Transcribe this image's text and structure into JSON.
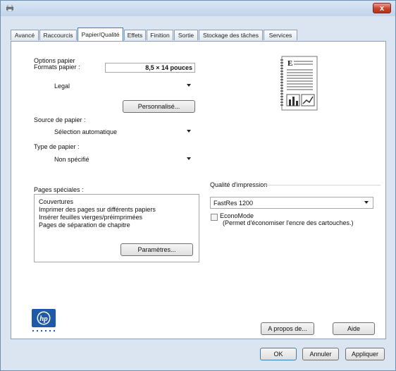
{
  "window": {
    "close_label": "x"
  },
  "tabs": [
    "Avancé",
    "Raccourcis",
    "Papier/Qualité",
    "Effets",
    "Finition",
    "Sortie",
    "Stockage des tâches",
    "Services"
  ],
  "active_tab": "Papier/Qualité",
  "paper_options": {
    "group_label": "Options papier",
    "formats_label": "Formats papier :",
    "format_size": "8,5 × 14 pouces",
    "format_selected": "Legal",
    "custom_button": "Personnalisé...",
    "source_label": "Source de papier :",
    "source_selected": "Sélection automatique",
    "type_label": "Type de papier :",
    "type_selected": "Non spécifié"
  },
  "special_pages": {
    "label": "Pages spéciales :",
    "items": [
      "Couvertures",
      "Imprimer des pages sur différents papiers",
      "Insérer feuilles vierges/préimprimées",
      "Pages de séparation de chapitre"
    ],
    "settings_button": "Paramètres..."
  },
  "print_quality": {
    "group_label": "Qualité d'impression",
    "selected": "FastRes 1200",
    "econo_label": "EconoMode",
    "econo_desc": "(Permet d'économiser l'encre des cartouches.)",
    "econo_checked": false
  },
  "bottom": {
    "about_button": "A propos de...",
    "help_button": "Aide",
    "ok_button": "OK",
    "cancel_button": "Annuler",
    "apply_button": "Appliquer"
  },
  "colors": {
    "accent": "#3c7fb1",
    "hp_blue": "#1e5aa8",
    "close_red": "#c9422a"
  },
  "icons": [
    "printer-icon",
    "close-icon",
    "document-preview-icon",
    "hp-logo"
  ]
}
